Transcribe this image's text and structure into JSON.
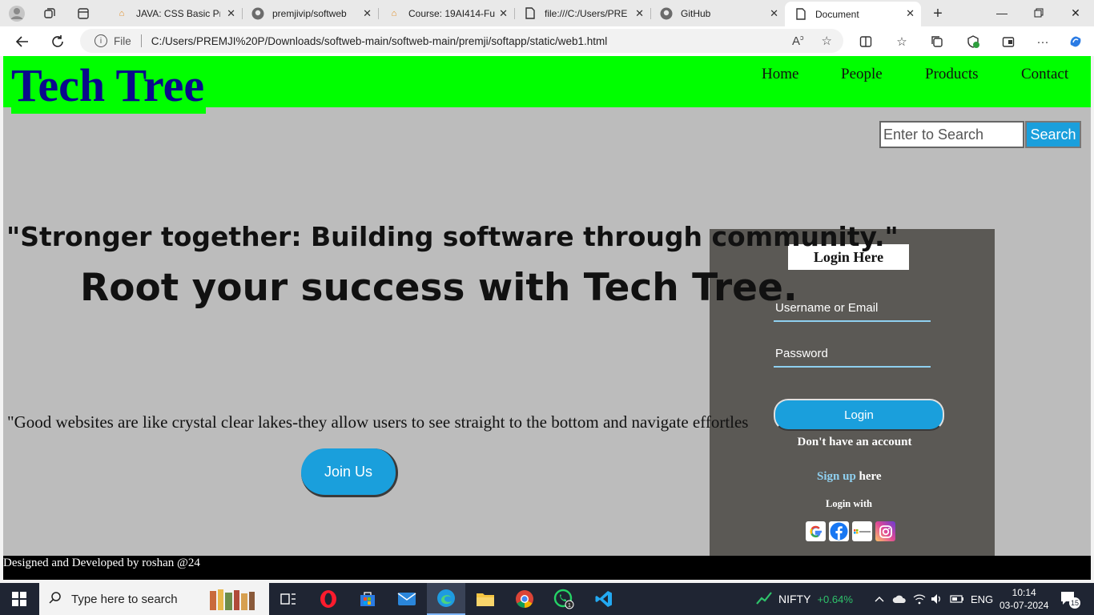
{
  "browser": {
    "tabs": [
      {
        "title": "JAVA: CSS Basic Proj",
        "active": false
      },
      {
        "title": "premjivip/softweb",
        "active": false
      },
      {
        "title": "Course: 19AI414-Fu",
        "active": false
      },
      {
        "title": "file:///C:/Users/PRE",
        "active": false
      },
      {
        "title": "GitHub",
        "active": false
      },
      {
        "title": "Document",
        "active": true
      }
    ],
    "address": {
      "scheme_label": "File",
      "url": "C:/Users/PREMJI%20P/Downloads/softweb-main/softweb-main/premji/softapp/static/web1.html"
    }
  },
  "site": {
    "brand": "Tech Tree",
    "nav": [
      "Home",
      "People",
      "Products",
      "Contact"
    ],
    "search": {
      "placeholder": "Enter to Search",
      "button": "Search"
    },
    "quote_top": "\"Stronger together: Building software through community.\"",
    "slogan": "Root your success with Tech Tree.",
    "quote_bottom": "\"Good websites are like crystal clear lakes-they allow users to see straight to the bottom and navigate effortles",
    "join_button": "Join Us",
    "login": {
      "title": "Login Here",
      "username_placeholder": "Username or Email",
      "password_placeholder": "Password",
      "button": "Login",
      "no_account": "Don't have an account",
      "signup_link": "Sign up",
      "signup_suffix": " here",
      "login_with": "Login with",
      "providers": [
        "google-icon",
        "facebook-icon",
        "microsoft-icon",
        "instagram-icon"
      ]
    },
    "footer": "Designed and Developed by roshan @24",
    "colors": {
      "header": "#00ff00",
      "brand_text": "#0a0a8c",
      "accent": "#1a9fdc",
      "page_bg": "#bcbcbc",
      "panel_bg": "#5b5955"
    }
  },
  "taskbar": {
    "search_placeholder": "Type here to search",
    "stock": {
      "name": "NIFTY",
      "change": "+0.64%"
    },
    "lang": "ENG",
    "time": "10:14",
    "date": "03-07-2024",
    "notifications": "15"
  }
}
